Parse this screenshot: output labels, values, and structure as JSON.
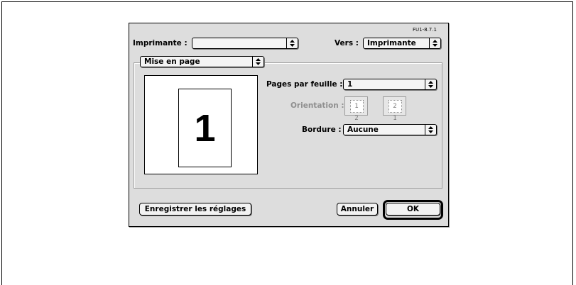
{
  "dialog": {
    "version_label": "FU1-8.7.1",
    "printer_label": "Imprimante :",
    "printer_value": "",
    "destination_label": "Vers :",
    "destination_value": "Imprimante",
    "panel_value": "Mise en page"
  },
  "layout": {
    "pages_per_sheet_label": "Pages par feuille :",
    "pages_per_sheet_value": "1",
    "orientation_label": "Orientation :",
    "orientation_options": [
      "1 2",
      "2 1"
    ],
    "border_label": "Bordure :",
    "border_value": "Aucune",
    "preview_number": "1"
  },
  "buttons": {
    "save_settings": "Enregistrer les réglages",
    "cancel": "Annuler",
    "ok": "OK"
  }
}
